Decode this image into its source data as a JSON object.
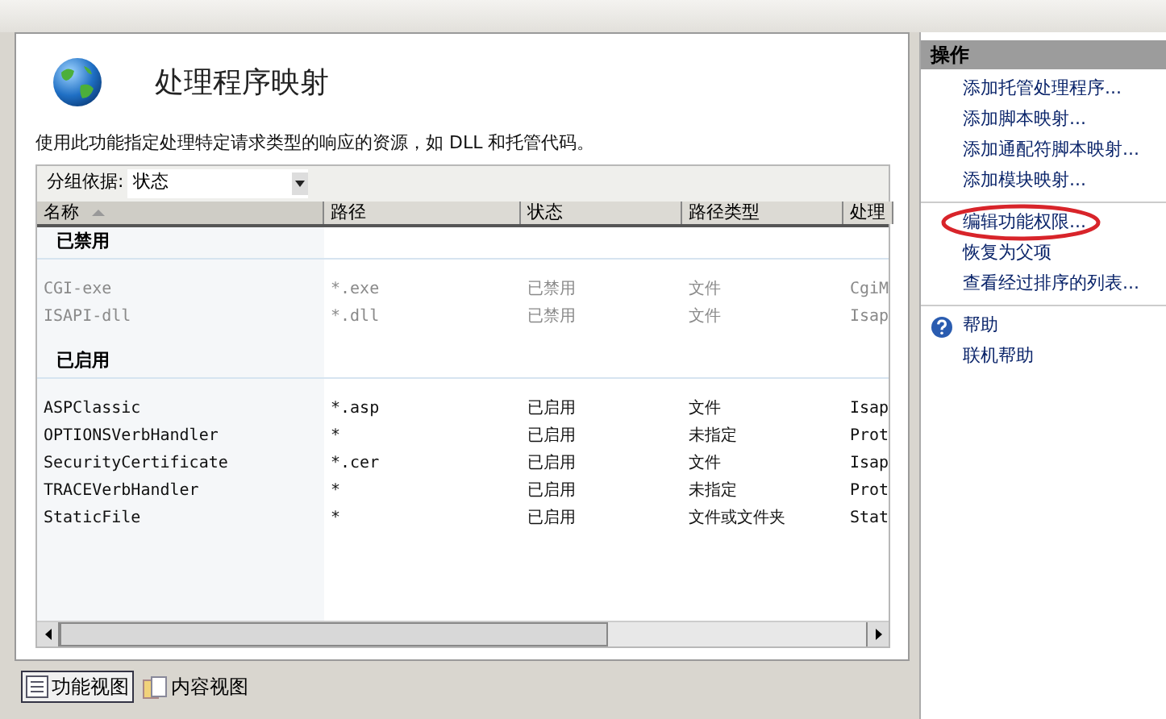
{
  "feature": {
    "title": "处理程序映射",
    "description": "使用此功能指定处理特定请求类型的响应的资源，如 DLL 和托管代码。"
  },
  "group_by": {
    "label": "分组依据:",
    "value": "状态"
  },
  "columns": [
    {
      "label": "名称",
      "sorted": true
    },
    {
      "label": "路径",
      "sorted": false
    },
    {
      "label": "状态",
      "sorted": false
    },
    {
      "label": "路径类型",
      "sorted": false
    },
    {
      "label": "处理",
      "sorted": false
    }
  ],
  "groups": [
    {
      "label": "已禁用",
      "rows": [
        {
          "disabled": true,
          "cells": [
            "CGI-exe",
            "*.exe",
            "已禁用",
            "文件",
            "CgiM"
          ]
        },
        {
          "disabled": true,
          "cells": [
            "ISAPI-dll",
            "*.dll",
            "已禁用",
            "文件",
            "Isap"
          ]
        }
      ]
    },
    {
      "label": "已启用",
      "rows": [
        {
          "disabled": false,
          "cells": [
            "ASPClassic",
            "*.asp",
            "已启用",
            "文件",
            "Isap"
          ]
        },
        {
          "disabled": false,
          "cells": [
            "OPTIONSVerbHandler",
            "*",
            "已启用",
            "未指定",
            "Prot"
          ]
        },
        {
          "disabled": false,
          "cells": [
            "SecurityCertificate",
            "*.cer",
            "已启用",
            "文件",
            "Isap"
          ]
        },
        {
          "disabled": false,
          "cells": [
            "TRACEVerbHandler",
            "*",
            "已启用",
            "未指定",
            "Prot"
          ]
        },
        {
          "disabled": false,
          "cells": [
            "StaticFile",
            "*",
            "已启用",
            "文件或文件夹",
            "Stat"
          ]
        }
      ]
    }
  ],
  "view_tabs": [
    {
      "label": "功能视图",
      "selected": true,
      "kind": "features"
    },
    {
      "label": "内容视图",
      "selected": false,
      "kind": "content"
    }
  ],
  "actions": {
    "title": "操作",
    "sections": [
      [
        {
          "label": "添加托管处理程序...",
          "kind": "link",
          "circled": false
        },
        {
          "label": "添加脚本映射...",
          "kind": "link",
          "circled": false
        },
        {
          "label": "添加通配符脚本映射...",
          "kind": "link",
          "circled": false
        },
        {
          "label": "添加模块映射...",
          "kind": "link",
          "circled": false
        }
      ],
      [
        {
          "label": "编辑功能权限...",
          "kind": "link",
          "circled": true
        },
        {
          "label": "恢复为父项",
          "kind": "link",
          "circled": false
        },
        {
          "label": "查看经过排序的列表...",
          "kind": "link",
          "circled": false
        }
      ],
      [
        {
          "label": "帮助",
          "kind": "help",
          "circled": false
        },
        {
          "label": "联机帮助",
          "kind": "link",
          "circled": false
        }
      ]
    ]
  }
}
